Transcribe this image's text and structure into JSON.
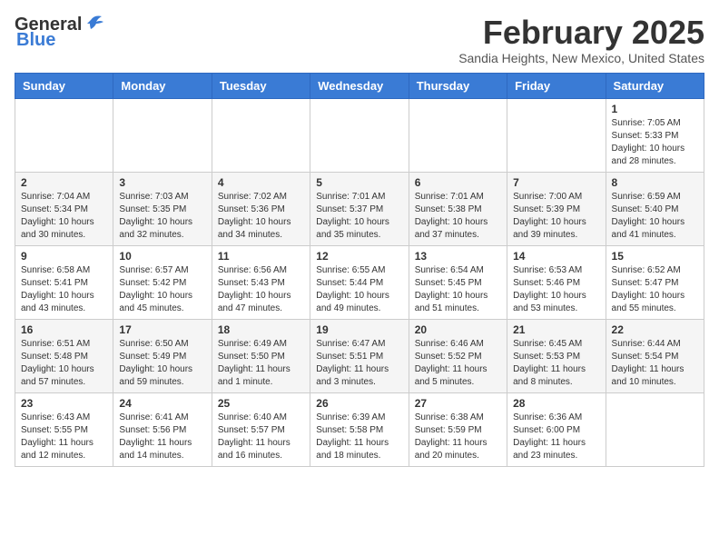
{
  "header": {
    "logo_general": "General",
    "logo_blue": "Blue",
    "month_title": "February 2025",
    "location": "Sandia Heights, New Mexico, United States"
  },
  "weekdays": [
    "Sunday",
    "Monday",
    "Tuesday",
    "Wednesday",
    "Thursday",
    "Friday",
    "Saturday"
  ],
  "weeks": [
    [
      {
        "day": "",
        "info": ""
      },
      {
        "day": "",
        "info": ""
      },
      {
        "day": "",
        "info": ""
      },
      {
        "day": "",
        "info": ""
      },
      {
        "day": "",
        "info": ""
      },
      {
        "day": "",
        "info": ""
      },
      {
        "day": "1",
        "info": "Sunrise: 7:05 AM\nSunset: 5:33 PM\nDaylight: 10 hours and 28 minutes."
      }
    ],
    [
      {
        "day": "2",
        "info": "Sunrise: 7:04 AM\nSunset: 5:34 PM\nDaylight: 10 hours and 30 minutes."
      },
      {
        "day": "3",
        "info": "Sunrise: 7:03 AM\nSunset: 5:35 PM\nDaylight: 10 hours and 32 minutes."
      },
      {
        "day": "4",
        "info": "Sunrise: 7:02 AM\nSunset: 5:36 PM\nDaylight: 10 hours and 34 minutes."
      },
      {
        "day": "5",
        "info": "Sunrise: 7:01 AM\nSunset: 5:37 PM\nDaylight: 10 hours and 35 minutes."
      },
      {
        "day": "6",
        "info": "Sunrise: 7:01 AM\nSunset: 5:38 PM\nDaylight: 10 hours and 37 minutes."
      },
      {
        "day": "7",
        "info": "Sunrise: 7:00 AM\nSunset: 5:39 PM\nDaylight: 10 hours and 39 minutes."
      },
      {
        "day": "8",
        "info": "Sunrise: 6:59 AM\nSunset: 5:40 PM\nDaylight: 10 hours and 41 minutes."
      }
    ],
    [
      {
        "day": "9",
        "info": "Sunrise: 6:58 AM\nSunset: 5:41 PM\nDaylight: 10 hours and 43 minutes."
      },
      {
        "day": "10",
        "info": "Sunrise: 6:57 AM\nSunset: 5:42 PM\nDaylight: 10 hours and 45 minutes."
      },
      {
        "day": "11",
        "info": "Sunrise: 6:56 AM\nSunset: 5:43 PM\nDaylight: 10 hours and 47 minutes."
      },
      {
        "day": "12",
        "info": "Sunrise: 6:55 AM\nSunset: 5:44 PM\nDaylight: 10 hours and 49 minutes."
      },
      {
        "day": "13",
        "info": "Sunrise: 6:54 AM\nSunset: 5:45 PM\nDaylight: 10 hours and 51 minutes."
      },
      {
        "day": "14",
        "info": "Sunrise: 6:53 AM\nSunset: 5:46 PM\nDaylight: 10 hours and 53 minutes."
      },
      {
        "day": "15",
        "info": "Sunrise: 6:52 AM\nSunset: 5:47 PM\nDaylight: 10 hours and 55 minutes."
      }
    ],
    [
      {
        "day": "16",
        "info": "Sunrise: 6:51 AM\nSunset: 5:48 PM\nDaylight: 10 hours and 57 minutes."
      },
      {
        "day": "17",
        "info": "Sunrise: 6:50 AM\nSunset: 5:49 PM\nDaylight: 10 hours and 59 minutes."
      },
      {
        "day": "18",
        "info": "Sunrise: 6:49 AM\nSunset: 5:50 PM\nDaylight: 11 hours and 1 minute."
      },
      {
        "day": "19",
        "info": "Sunrise: 6:47 AM\nSunset: 5:51 PM\nDaylight: 11 hours and 3 minutes."
      },
      {
        "day": "20",
        "info": "Sunrise: 6:46 AM\nSunset: 5:52 PM\nDaylight: 11 hours and 5 minutes."
      },
      {
        "day": "21",
        "info": "Sunrise: 6:45 AM\nSunset: 5:53 PM\nDaylight: 11 hours and 8 minutes."
      },
      {
        "day": "22",
        "info": "Sunrise: 6:44 AM\nSunset: 5:54 PM\nDaylight: 11 hours and 10 minutes."
      }
    ],
    [
      {
        "day": "23",
        "info": "Sunrise: 6:43 AM\nSunset: 5:55 PM\nDaylight: 11 hours and 12 minutes."
      },
      {
        "day": "24",
        "info": "Sunrise: 6:41 AM\nSunset: 5:56 PM\nDaylight: 11 hours and 14 minutes."
      },
      {
        "day": "25",
        "info": "Sunrise: 6:40 AM\nSunset: 5:57 PM\nDaylight: 11 hours and 16 minutes."
      },
      {
        "day": "26",
        "info": "Sunrise: 6:39 AM\nSunset: 5:58 PM\nDaylight: 11 hours and 18 minutes."
      },
      {
        "day": "27",
        "info": "Sunrise: 6:38 AM\nSunset: 5:59 PM\nDaylight: 11 hours and 20 minutes."
      },
      {
        "day": "28",
        "info": "Sunrise: 6:36 AM\nSunset: 6:00 PM\nDaylight: 11 hours and 23 minutes."
      },
      {
        "day": "",
        "info": ""
      }
    ]
  ]
}
